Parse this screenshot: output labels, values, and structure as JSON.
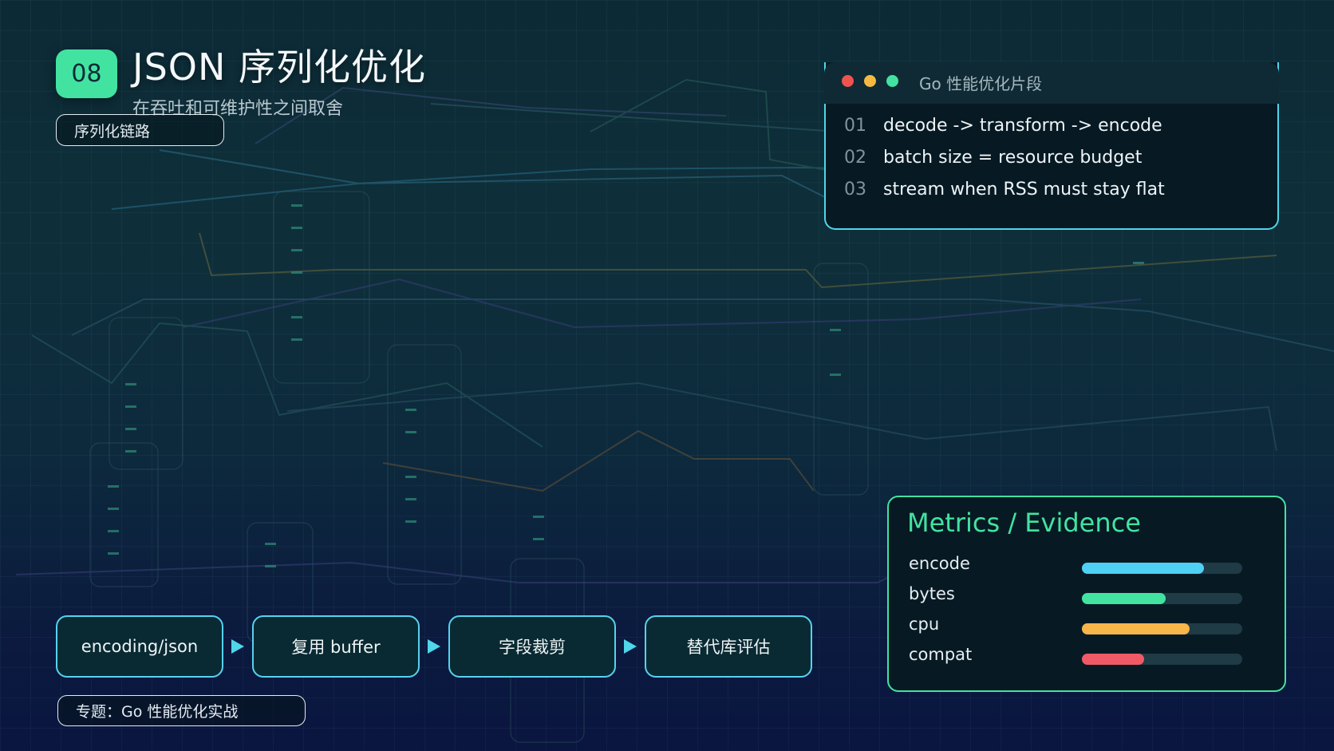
{
  "slide": {
    "number": "08",
    "title": "JSON 序列化优化",
    "subtitle": "在吞吐和可维护性之间取舍",
    "tag_top": "序列化链路",
    "tag_bottom": "专题：Go 性能优化实战"
  },
  "code_panel": {
    "title": "Go 性能优化片段",
    "dot_colors": [
      "#ef5350",
      "#f5b942",
      "#42e3a0"
    ],
    "lines": [
      {
        "num": "01",
        "text": "decode -> transform -> encode"
      },
      {
        "num": "02",
        "text": "batch size = resource budget"
      },
      {
        "num": "03",
        "text": "stream when RSS must stay flat"
      }
    ]
  },
  "metrics": {
    "title": "Metrics / Evidence",
    "items": [
      {
        "label": "encode",
        "value": 0.76,
        "color": "#4fd0f5"
      },
      {
        "label": "bytes",
        "value": 0.52,
        "color": "#42e3a0"
      },
      {
        "label": "cpu",
        "value": 0.67,
        "color": "#f7b54a"
      },
      {
        "label": "compat",
        "value": 0.39,
        "color": "#f05a66"
      }
    ]
  },
  "pipeline": {
    "steps": [
      "encoding/json",
      "复用 buffer",
      "字段裁剪",
      "替代库评估"
    ]
  },
  "colors": {
    "accent": "#42e3a0",
    "border": "#4fd6ea"
  }
}
